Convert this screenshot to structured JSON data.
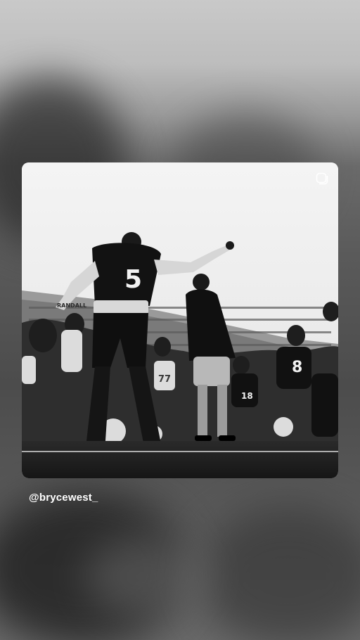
{
  "story": {
    "mention": "@brycewest_",
    "image": {
      "description_hidden": false,
      "jersey_primary": "5",
      "jersey_secondary": "8",
      "jersey_tertiary": "18",
      "jersey_fourth": "77",
      "stadium_sign": "RANDALL"
    },
    "icons": {
      "sticker": "copy-sticker-icon"
    },
    "colors": {
      "text": "#ffffff",
      "card_bg": "#e9e9e9"
    }
  }
}
